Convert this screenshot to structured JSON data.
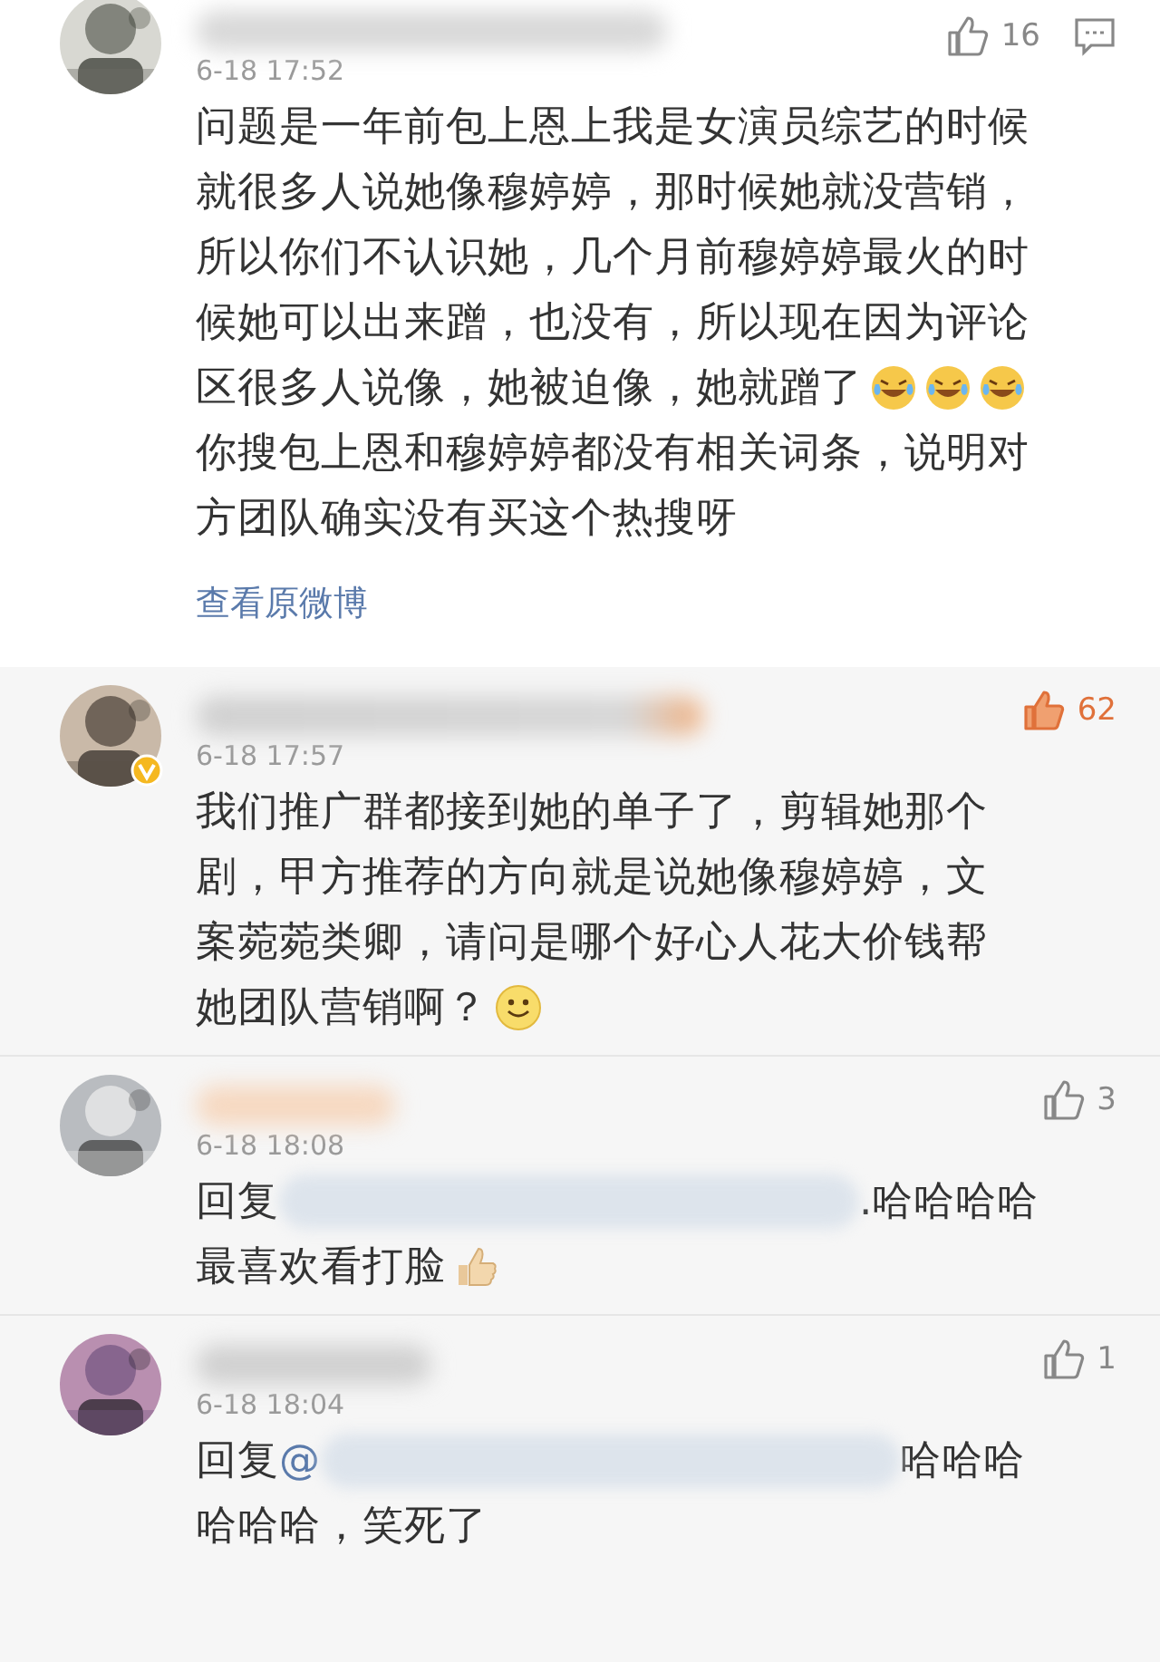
{
  "post_comment": {
    "time": "6-18 17:52",
    "likes": "16",
    "liked": false,
    "verified": false,
    "show_reply": true,
    "lines": [
      {
        "parts": [
          {
            "kind": "text",
            "text": "问题是一年前包上恩上我是女演员综艺的时候"
          }
        ]
      },
      {
        "parts": [
          {
            "kind": "text",
            "text": "就很多人说她像穆婷婷，那时候她就没营销，"
          }
        ]
      },
      {
        "parts": [
          {
            "kind": "text",
            "text": "所以你们不认识她，几个月前穆婷婷最火的时"
          }
        ]
      },
      {
        "parts": [
          {
            "kind": "text",
            "text": "候她可以出来蹭，也没有，所以现在因为评论"
          }
        ]
      },
      {
        "parts": [
          {
            "kind": "text",
            "text": "区很多人说像，她被迫像，她就蹭了"
          },
          {
            "kind": "laugh-cry"
          },
          {
            "kind": "laugh-cry"
          },
          {
            "kind": "laugh-cry"
          }
        ]
      },
      {
        "parts": [
          {
            "kind": "text",
            "text": "你搜包上恩和穆婷婷都没有相关词条，说明对"
          }
        ]
      },
      {
        "parts": [
          {
            "kind": "text",
            "text": "方团队确实没有买这个热搜呀"
          }
        ]
      }
    ],
    "link": "查看原微博"
  },
  "comments": [
    {
      "time": "6-18 17:57",
      "likes": "62",
      "liked": true,
      "verified": true,
      "show_reply": false,
      "lines": [
        {
          "parts": [
            {
              "kind": "text",
              "text": "我们推广群都接到她的单子了，剪辑她那个"
            }
          ]
        },
        {
          "parts": [
            {
              "kind": "text",
              "text": "剧，甲方推荐的方向就是说她像穆婷婷，文"
            }
          ]
        },
        {
          "parts": [
            {
              "kind": "text",
              "text": "案菀菀类卿，请问是哪个好心人花大价钱帮"
            }
          ]
        },
        {
          "parts": [
            {
              "kind": "text",
              "text": "她团队营销啊？"
            },
            {
              "kind": "smile"
            }
          ]
        }
      ]
    },
    {
      "time": "6-18 18:08",
      "likes": "3",
      "liked": false,
      "verified": false,
      "show_reply": false,
      "lines": [
        {
          "parts": [
            {
              "kind": "text",
              "text": "回复"
            },
            {
              "kind": "redacted"
            },
            {
              "kind": "text",
              "text": ".哈哈哈哈"
            }
          ]
        },
        {
          "parts": [
            {
              "kind": "text",
              "text": "最喜欢看打脸"
            },
            {
              "kind": "thumbs-up"
            }
          ]
        }
      ]
    },
    {
      "time": "6-18 18:04",
      "likes": "1",
      "liked": false,
      "verified": false,
      "show_reply": false,
      "lines": [
        {
          "parts": [
            {
              "kind": "text",
              "text": "回复"
            },
            {
              "kind": "mention",
              "text": "@"
            },
            {
              "kind": "redacted"
            },
            {
              "kind": "text",
              "text": "哈哈哈"
            }
          ]
        },
        {
          "parts": [
            {
              "kind": "text",
              "text": "哈哈哈，笑死了"
            }
          ]
        }
      ]
    }
  ]
}
